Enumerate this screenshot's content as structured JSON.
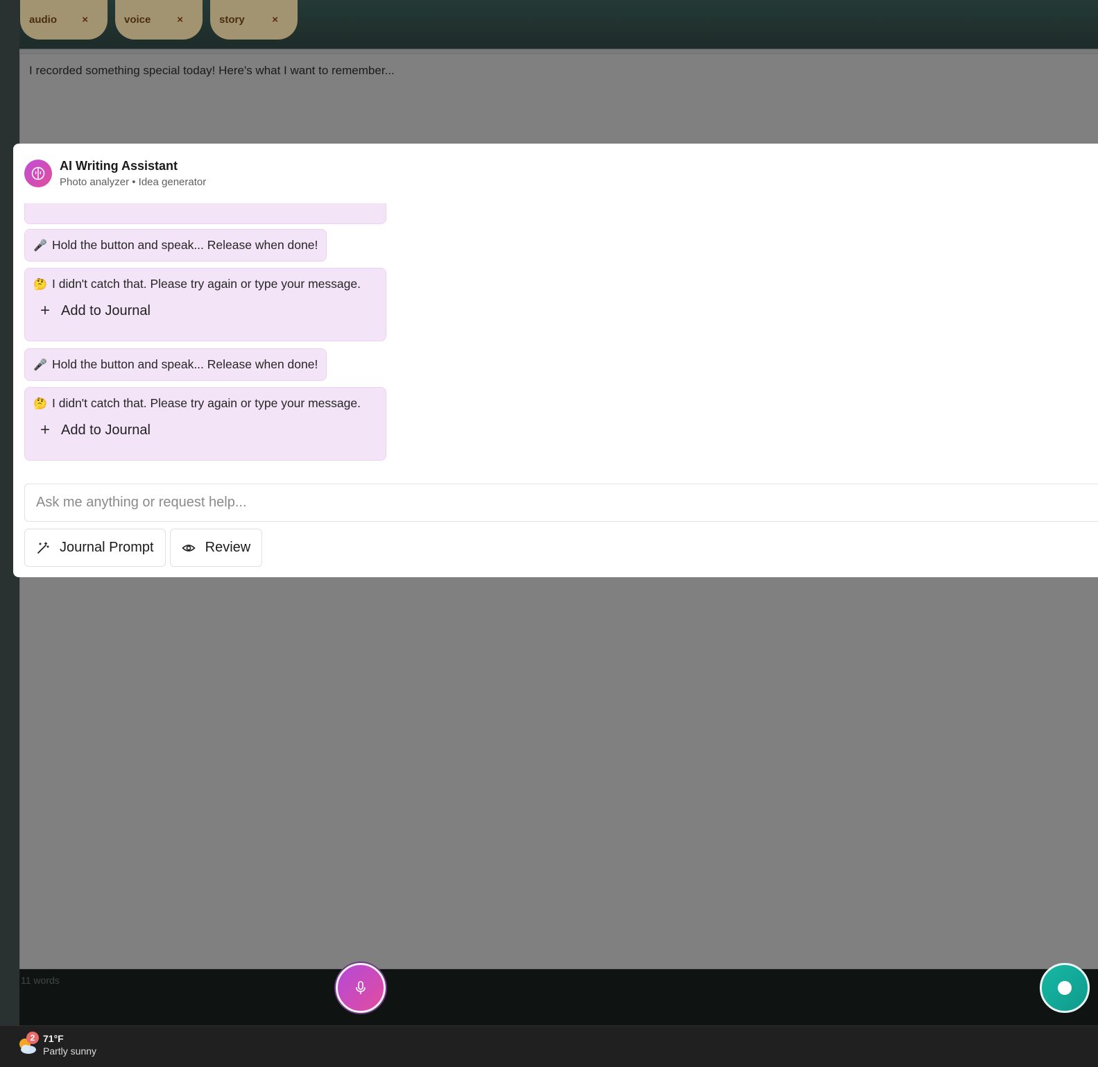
{
  "tags": [
    {
      "label": "audio"
    },
    {
      "label": "voice"
    },
    {
      "label": "story"
    }
  ],
  "tag_remove_glyph": "×",
  "editor": {
    "text": "I recorded something special today! Here's what I want to remember...",
    "word_count": "11 words"
  },
  "assistant": {
    "title": "AI Writing Assistant",
    "subtitle": "Photo analyzer • Idea generator",
    "messages": [
      {
        "emoji": "🎤",
        "text": "Hold the button and speak... Release when done!"
      },
      {
        "emoji": "🤔",
        "text": "I didn't catch that. Please try again or type your message.",
        "action": "Add to Journal"
      },
      {
        "emoji": "🎤",
        "text": "Hold the button and speak... Release when done!"
      },
      {
        "emoji": "🤔",
        "text": "I didn't catch that. Please try again or type your message.",
        "action": "Add to Journal"
      }
    ],
    "input_placeholder": "Ask me anything or request help...",
    "buttons": {
      "journal_prompt": "Journal Prompt",
      "review": "Review"
    }
  },
  "taskbar": {
    "weather_temp": "71°F",
    "weather_condition": "Partly sunny",
    "notification_count": "2"
  },
  "colors": {
    "assistant_accent": "#c14fd8",
    "record_accent": "#17b8a4",
    "message_bg": "#f4e4f7",
    "tag_bg": "#a39471"
  }
}
